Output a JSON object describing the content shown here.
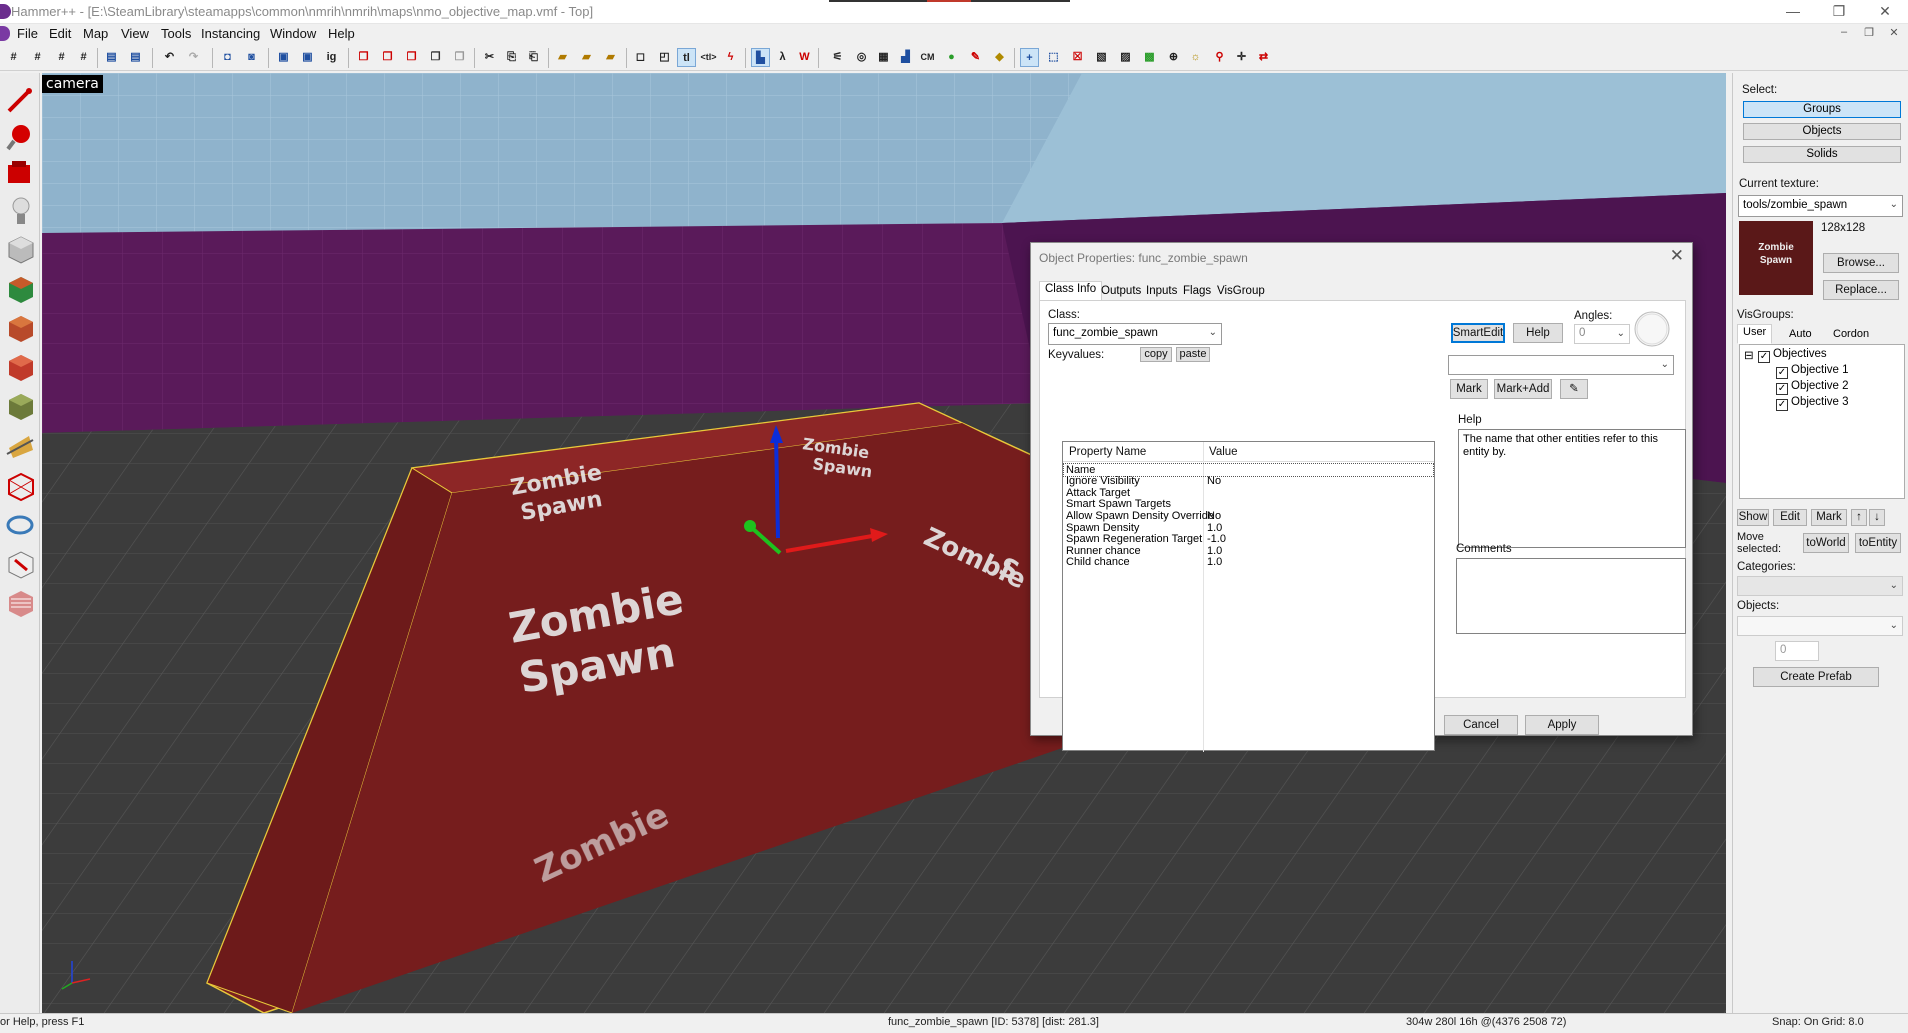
{
  "window": {
    "title": "Hammer++ - [E:\\SteamLibrary\\steamapps\\common\\nmrih\\nmrih\\maps\\nmo_objective_map.vmf - Top]",
    "min_glyph": "—",
    "max_glyph": "❐",
    "close_glyph": "✕"
  },
  "menu": {
    "items": [
      "File",
      "Edit",
      "Map",
      "View",
      "Tools",
      "Instancing",
      "Window",
      "Help"
    ],
    "mdi_min": "–",
    "mdi_restore": "❐",
    "mdi_close": "✕"
  },
  "toolbar": {
    "cm_label": "CM",
    "tl_label": "tl",
    "txt_label": "<tl>",
    "ig_label": "ig"
  },
  "viewport": {
    "label": "camera",
    "floor_text": [
      "Zombie",
      "Spawn",
      "Zombie",
      "Spawn",
      "Zombie",
      "Spawn",
      "Zombie",
      "Zombie",
      "S"
    ]
  },
  "dialog": {
    "title": "Object Properties: func_zombie_spawn",
    "close_glyph": "✕",
    "tabs": [
      "Class Info",
      "Outputs",
      "Inputs",
      "Flags",
      "VisGroup"
    ],
    "class_label": "Class:",
    "class_value": "func_zombie_spawn",
    "keyvalues_label": "Keyvalues:",
    "copy_label": "copy",
    "paste_label": "paste",
    "smartedit_label": "SmartEdit",
    "help_label": "Help",
    "angles_label": "Angles:",
    "angles_value": "0",
    "col_property": "Property Name",
    "col_value": "Value",
    "properties": [
      {
        "name": "Name",
        "value": ""
      },
      {
        "name": "Ignore Visibility",
        "value": "No"
      },
      {
        "name": "Attack Target",
        "value": ""
      },
      {
        "name": "Smart Spawn Targets",
        "value": ""
      },
      {
        "name": "Allow Spawn Density Override",
        "value": "No"
      },
      {
        "name": "Spawn Density",
        "value": "1.0"
      },
      {
        "name": "Spawn Regeneration Target",
        "value": "-1.0"
      },
      {
        "name": "Runner chance",
        "value": "1.0"
      },
      {
        "name": "Child chance",
        "value": "1.0"
      }
    ],
    "mark_label": "Mark",
    "markadd_label": "Mark+Add",
    "help_heading": "Help",
    "help_text": "The name that other entities refer to this entity by.",
    "comments_heading": "Comments",
    "cancel_label": "Cancel",
    "apply_label": "Apply"
  },
  "right_panel": {
    "select_label": "Select:",
    "select_buttons": [
      "Groups",
      "Objects",
      "Solids"
    ],
    "current_texture_label": "Current texture:",
    "texture_name": "tools/zombie_spawn",
    "texture_size": "128x128",
    "texture_thumb_text": [
      "Zombie",
      "Spawn"
    ],
    "browse_label": "Browse...",
    "replace_label": "Replace...",
    "visgroups_label": "VisGroups:",
    "vis_tabs": [
      "User",
      "Auto",
      "Cordon"
    ],
    "vis_tree": [
      {
        "label": "Objectives",
        "level": 0
      },
      {
        "label": "Objective 1",
        "level": 1
      },
      {
        "label": "Objective 2",
        "level": 1
      },
      {
        "label": "Objective 3",
        "level": 1
      }
    ],
    "tree_expander": "⊟",
    "show_label": "Show",
    "edit_label": "Edit",
    "mark_label": "Mark",
    "up_label": "↑",
    "down_label": "↓",
    "move_selected_label": "Move selected:",
    "toworld_label": "toWorld",
    "toentity_label": "toEntity",
    "categories_label": "Categories:",
    "objects_label": "Objects:",
    "spinner_value": "0",
    "create_prefab_label": "Create Prefab"
  },
  "status": {
    "left": "or Help, press F1",
    "mid": "func_zombie_spawn [ID: 5378] [dist: 281.3]",
    "size": "304w 280l 16h @(4376 2508 72)",
    "snap": "Snap: On Grid: 8.0"
  }
}
